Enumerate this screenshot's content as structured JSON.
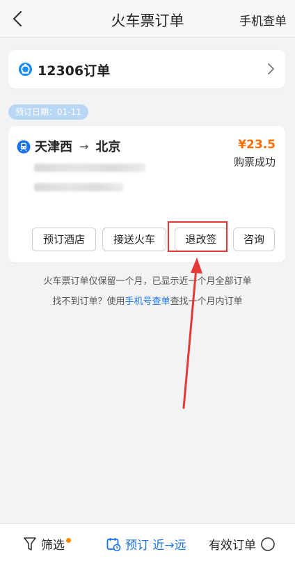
{
  "header": {
    "title": "火车票订单",
    "action_label": "手机查单"
  },
  "source_card": {
    "label": "12306订单"
  },
  "order": {
    "date_chip": "预订日期：01-11",
    "from": "天津西",
    "arrow": "→",
    "to": "北京",
    "price": "¥23.5",
    "status": "购票成功",
    "buttons": {
      "hotel": "预订酒店",
      "pickup": "接送火车",
      "change": "退改签",
      "consult": "咨询"
    }
  },
  "notes": {
    "line1": "火车票订单仅保留一个月，已显示近一个月全部订单",
    "line2_prefix": "找不到订单？使用",
    "line2_link": "手机号查单",
    "line2_suffix": "查找一个月内订单"
  },
  "bottom_bar": {
    "filter_label": "筛选",
    "sort_label": "预订 近→远",
    "valid_label": "有效订单"
  },
  "colors": {
    "accent_blue": "#1a73e8",
    "price_orange": "#ff6b00",
    "annotation_red": "#e53935",
    "date_chip_bg": "#b9d7f5"
  },
  "icons": {
    "back": "chevron-left-icon",
    "source_logo": "12306-logo-icon",
    "chevron": "chevron-right-icon",
    "train": "train-icon",
    "filter": "filter-icon",
    "calendar": "calendar-icon",
    "valid": "circle-icon"
  }
}
